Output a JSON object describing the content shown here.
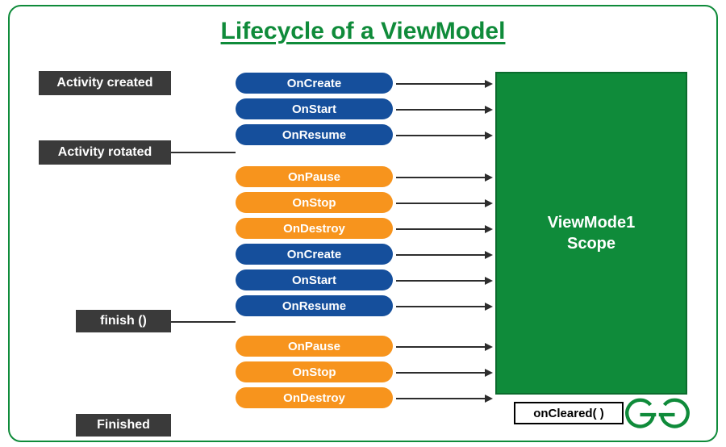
{
  "title": "Lifecycle of a ViewModel",
  "left_labels": {
    "created": "Activity created",
    "rotated": "Activity rotated",
    "finish": "finish ()",
    "finished": "Finished"
  },
  "pills": [
    {
      "text": "OnCreate",
      "color": "blue"
    },
    {
      "text": "OnStart",
      "color": "blue"
    },
    {
      "text": "OnResume",
      "color": "blue"
    },
    {
      "text": "OnPause",
      "color": "orange"
    },
    {
      "text": "OnStop",
      "color": "orange"
    },
    {
      "text": "OnDestroy",
      "color": "orange"
    },
    {
      "text": "OnCreate",
      "color": "blue"
    },
    {
      "text": "OnStart",
      "color": "blue"
    },
    {
      "text": "OnResume",
      "color": "blue"
    },
    {
      "text": "OnPause",
      "color": "orange"
    },
    {
      "text": "OnStop",
      "color": "orange"
    },
    {
      "text": "OnDestroy",
      "color": "orange"
    }
  ],
  "scope": {
    "line1": "ViewMode1",
    "line2": "Scope"
  },
  "cleared": "onCleared( )",
  "colors": {
    "green": "#0f8b3a",
    "blue": "#154f9c",
    "orange": "#f7941d",
    "dark": "#3a3a3a"
  },
  "logo_name": "geeksforgeeks-logo"
}
